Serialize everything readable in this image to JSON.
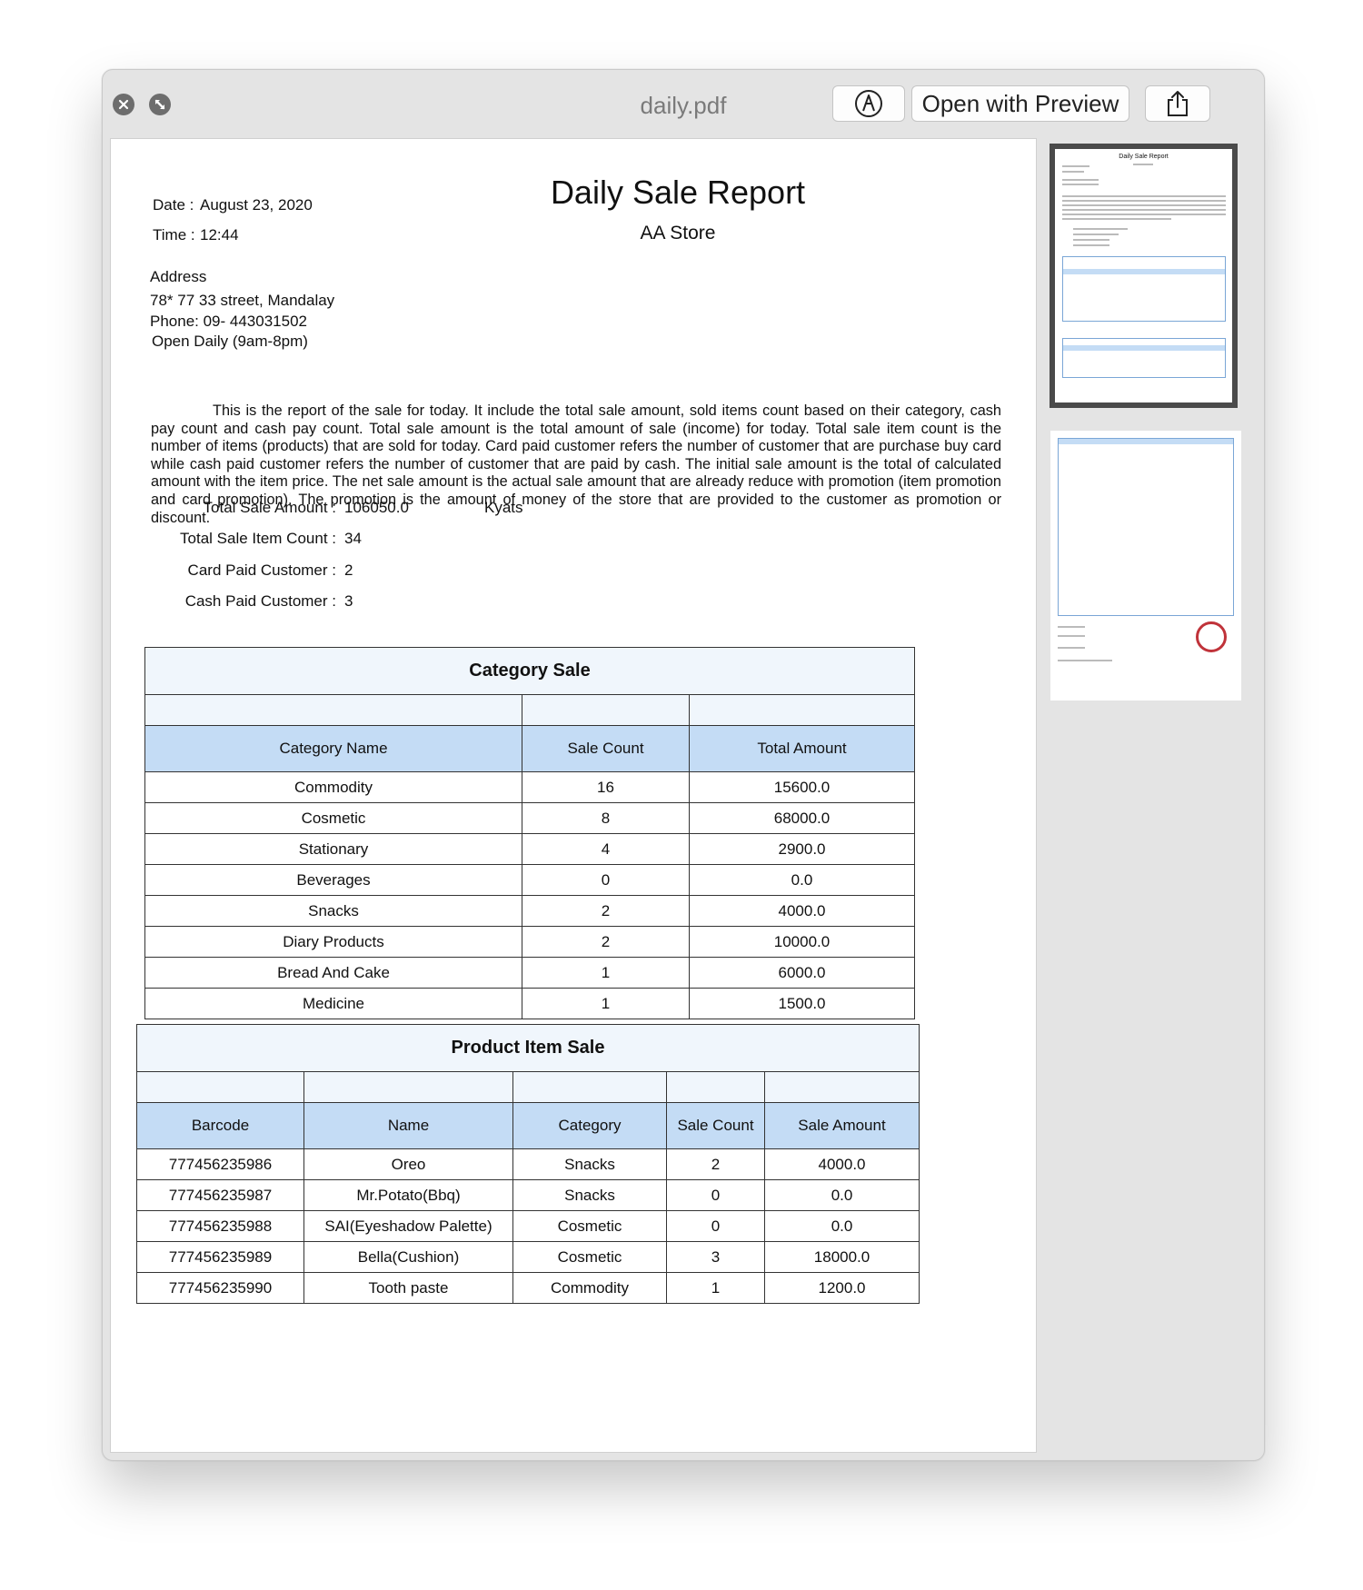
{
  "window": {
    "title": "daily.pdf",
    "open_with_label": "Open with Preview",
    "markup_icon": "markup-pen-icon",
    "share_icon": "share-icon",
    "close_icon": "close-icon",
    "fullscreen_icon": "fullscreen-icon"
  },
  "report": {
    "title": "Daily Sale Report",
    "store": "AA Store",
    "date_label": "Date :",
    "date_value": "August 23, 2020",
    "time_label": "Time :",
    "time_value": "12:44",
    "address_heading": "Address",
    "address_line": "78* 77 33 street, Mandalay",
    "phone": "Phone: 09- 443031502",
    "hours": "Open Daily (9am-8pm)",
    "description": "This is the report of the sale for today. It include the total sale amount, sold items count based on their category, cash pay count and cash pay count. Total sale amount is the total amount of sale (income) for today. Total sale item count is the number of items (products) that are sold for today.  Card paid customer refers the number of customer that are purchase buy card while cash paid customer refers the number of customer that are paid by cash. The initial sale amount is the total of calculated amount with the item price. The net sale amount is the actual sale amount that are already reduce with promotion (item promotion and card promotion). The promotion is the amount of money of the store that are provided to the customer as promotion or discount.",
    "summary": {
      "total_sale_label": "Total Sale Amount :",
      "total_sale_value": "106050.0",
      "currency": "Kyats",
      "item_count_label": "Total Sale Item Count :",
      "item_count_value": "34",
      "card_label": "Card Paid Customer :",
      "card_value": "2",
      "cash_label": "Cash Paid Customer :",
      "cash_value": "3"
    },
    "category_table": {
      "caption": "Category Sale",
      "headers": [
        "Category Name",
        "Sale Count",
        "Total Amount"
      ],
      "rows": [
        [
          "Commodity",
          "16",
          "15600.0"
        ],
        [
          "Cosmetic",
          "8",
          "68000.0"
        ],
        [
          "Stationary",
          "4",
          "2900.0"
        ],
        [
          "Beverages",
          "0",
          "0.0"
        ],
        [
          "Snacks",
          "2",
          "4000.0"
        ],
        [
          "Diary Products",
          "2",
          "10000.0"
        ],
        [
          "Bread And Cake",
          "1",
          "6000.0"
        ],
        [
          "Medicine",
          "1",
          "1500.0"
        ]
      ]
    },
    "product_table": {
      "caption": "Product Item Sale",
      "headers": [
        "Barcode",
        "Name",
        "Category",
        "Sale Count",
        "Sale Amount"
      ],
      "rows": [
        [
          "777456235986",
          "Oreo",
          "Snacks",
          "2",
          "4000.0"
        ],
        [
          "777456235987",
          "Mr.Potato(Bbq)",
          "Snacks",
          "0",
          "0.0"
        ],
        [
          "777456235988",
          "SAI(Eyeshadow Palette)",
          "Cosmetic",
          "0",
          "0.0"
        ],
        [
          "777456235989",
          "Bella(Cushion)",
          "Cosmetic",
          "3",
          "18000.0"
        ],
        [
          "777456235990",
          "Tooth paste",
          "Commodity",
          "1",
          "1200.0"
        ]
      ]
    }
  },
  "thumbnails": {
    "page1_title": "Daily Sale Report",
    "selected_page": 1,
    "page_count": 2
  }
}
